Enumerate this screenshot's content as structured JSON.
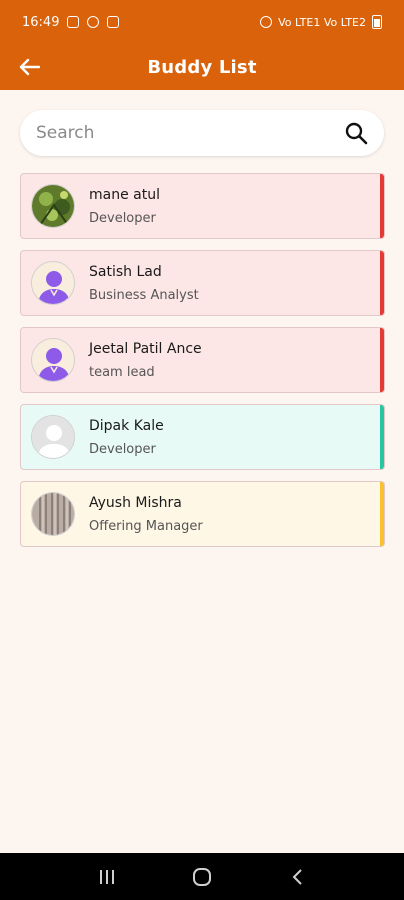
{
  "status_bar": {
    "time": "16:49",
    "right_text": "Vo LTE1 Vo LTE2"
  },
  "header": {
    "title": "Buddy List",
    "back_icon": "arrow-left-icon"
  },
  "search": {
    "placeholder": "Search",
    "value": "",
    "icon": "search-icon"
  },
  "buddies": [
    {
      "name": "mane atul",
      "role": "Developer",
      "bg": "#fde6e6",
      "stripe": "#e53935",
      "avatar": "photo-plant"
    },
    {
      "name": "Satish Lad",
      "role": "Business Analyst",
      "bg": "#fde6e6",
      "stripe": "#e53935",
      "avatar": "default-purple"
    },
    {
      "name": "Jeetal Patil Ance",
      "role": "team lead",
      "bg": "#fde6e6",
      "stripe": "#e53935",
      "avatar": "default-purple"
    },
    {
      "name": "Dipak Kale",
      "role": "Developer",
      "bg": "#e8faf5",
      "stripe": "#26c6a0",
      "avatar": "default-gray"
    },
    {
      "name": "Ayush Mishra",
      "role": "Offering Manager",
      "bg": "#fff7e6",
      "stripe": "#fbc02d",
      "avatar": "photo-texture"
    }
  ],
  "colors": {
    "header_bg": "#d9620a",
    "page_bg": "#fdf5f0"
  }
}
